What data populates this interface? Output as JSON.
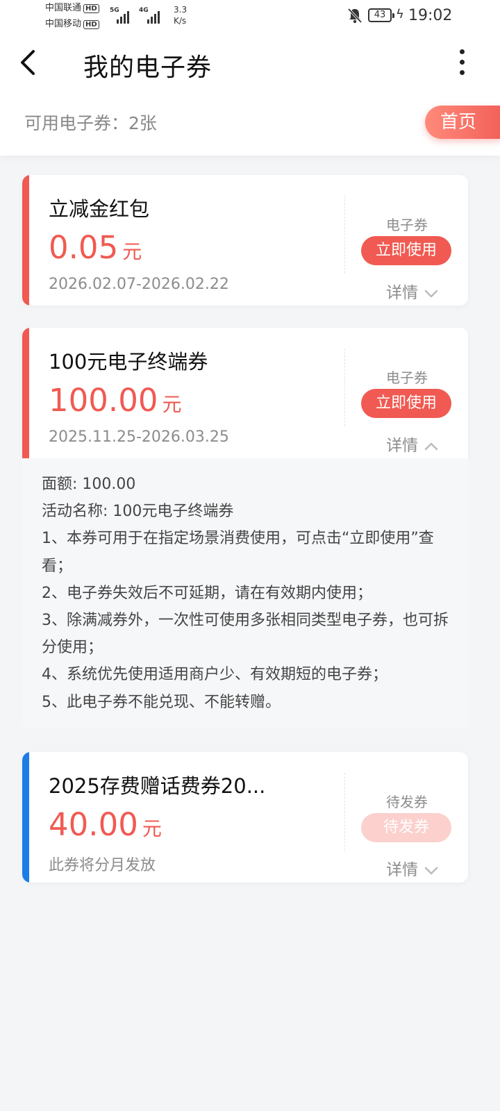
{
  "status_bar": {
    "carrier1": "中国联通",
    "carrier2": "中国移动",
    "hd": "HD",
    "net1": "5G",
    "net2": "4G",
    "speed_value": "3.3",
    "speed_unit": "K/s",
    "battery": "43",
    "time": "19:02"
  },
  "header": {
    "title": "我的电子券",
    "available": "可用电子券：2张",
    "home_button": "首页"
  },
  "coupons": [
    {
      "name": "立减金红包",
      "amount": "0.05",
      "unit": "元",
      "date": "2026.02.07-2026.02.22",
      "type": "电子券",
      "button": "立即使用",
      "detail": "详情",
      "stripe_color": "#f05a52"
    },
    {
      "name": "100元电子终端券",
      "amount": "100.00",
      "unit": "元",
      "date": "2025.11.25-2026.03.25",
      "type": "电子券",
      "button": "立即使用",
      "detail": "详情",
      "stripe_color": "#f05a52"
    },
    {
      "name": "2025存费赠话费券20...",
      "amount": "40.00",
      "unit": "元",
      "date": "此券将分月发放",
      "type": "待发券",
      "button": "待发券",
      "detail": "详情",
      "stripe_color": "#1e7ce6"
    }
  ],
  "details": {
    "face_value": "面额: 100.00",
    "activity": "活动名称: 100元电子终端券",
    "rule1": "1、本券可用于在指定场景消费使用，可点击“立即使用”查看；",
    "rule2": "2、电子券失效后不可延期，请在有效期内使用；",
    "rule3": "3、除满减券外，一次性可使用多张相同类型电子券，也可拆分使用；",
    "rule4": "4、系统优先使用适用商户少、有效期短的电子券；",
    "rule5": "5、此电子券不能兑现、不能转赠。"
  },
  "colors": {
    "accent": "#f05a52",
    "blue_stripe": "#1e7ce6",
    "disabled_button": "#fbd0cd"
  }
}
